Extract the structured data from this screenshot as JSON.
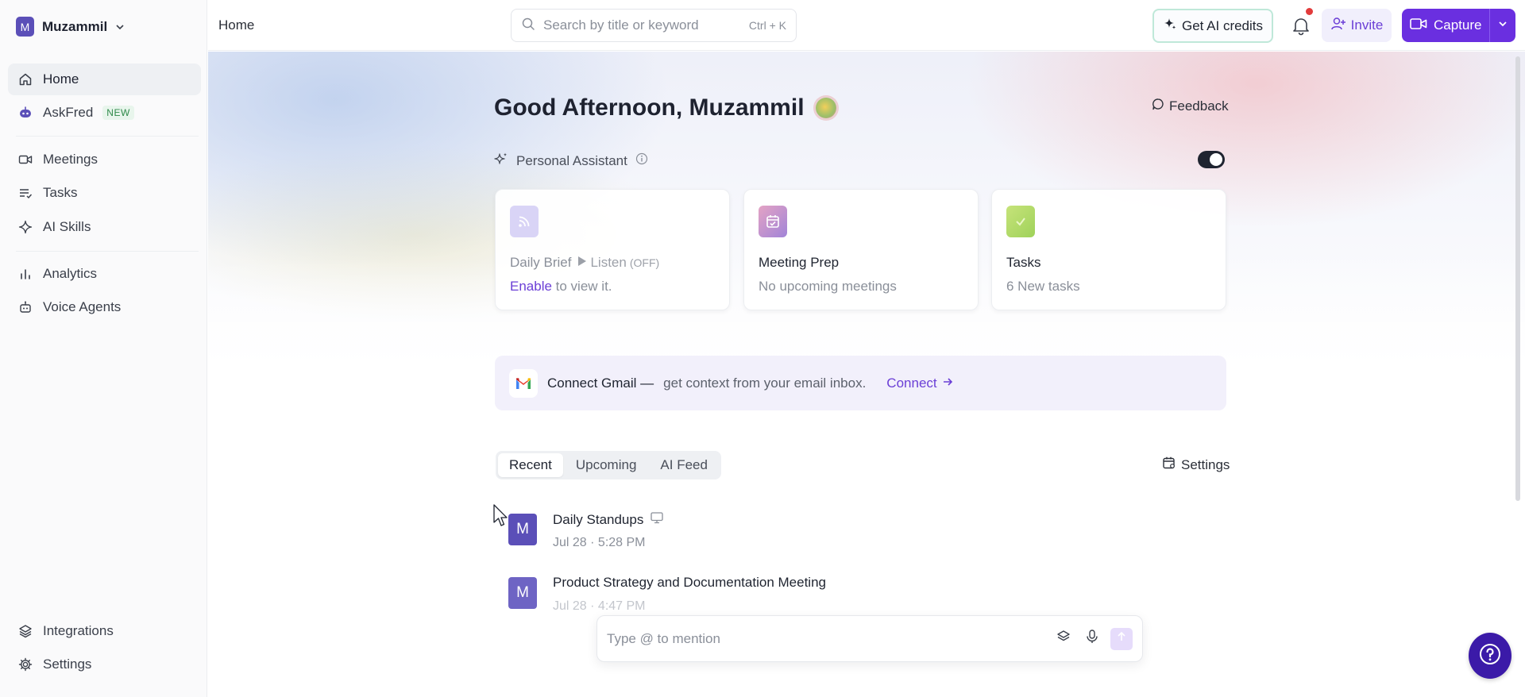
{
  "sidebar": {
    "workspace": {
      "initial": "M",
      "name": "Muzammil"
    },
    "items": [
      {
        "label": "Home",
        "icon": "home-icon"
      },
      {
        "label": "AskFred",
        "icon": "askfred-icon",
        "badge": "NEW"
      },
      {
        "label": "Meetings",
        "icon": "video-icon"
      },
      {
        "label": "Tasks",
        "icon": "tasks-icon"
      },
      {
        "label": "AI Skills",
        "icon": "sparkle-icon"
      },
      {
        "label": "Analytics",
        "icon": "analytics-icon"
      },
      {
        "label": "Voice Agents",
        "icon": "robot-icon"
      },
      {
        "label": "Integrations",
        "icon": "layers-icon"
      },
      {
        "label": "Settings",
        "icon": "gear-icon"
      }
    ]
  },
  "header": {
    "breadcrumb": "Home",
    "search": {
      "placeholder": "Search by title or keyword",
      "shortcut": "Ctrl + K"
    },
    "credits_label": "Get AI credits",
    "invite_label": "Invite",
    "capture_label": "Capture"
  },
  "main": {
    "greeting": "Good Afternoon, Muzammil",
    "feedback_label": "Feedback",
    "assistant_label": "Personal Assistant",
    "assistant_enabled": true,
    "cards": {
      "daily_brief": {
        "title": "Daily Brief",
        "listen": "Listen",
        "state": "(OFF)",
        "enable": "Enable",
        "rest": " to view it."
      },
      "meeting_prep": {
        "title": "Meeting Prep",
        "subtitle": "No upcoming meetings"
      },
      "tasks": {
        "title": "Tasks",
        "subtitle": "6 New tasks"
      }
    },
    "gmail": {
      "title": "Connect Gmail —",
      "body": "get context from your email inbox.",
      "cta": "Connect"
    },
    "tabs": [
      "Recent",
      "Upcoming",
      "AI Feed"
    ],
    "active_tab": "Recent",
    "settings_label": "Settings",
    "meetings": [
      {
        "initial": "M",
        "title": "Daily Standups",
        "date": "Jul 28",
        "time": "5:28 PM"
      },
      {
        "initial": "M",
        "title": "Product Strategy and Documentation Meeting",
        "date": "Jul 28",
        "time": "4:47 PM"
      }
    ],
    "composer_placeholder": "Type @ to mention"
  },
  "colors": {
    "brand": "#6a2fe0",
    "avatar": "#5b4fb8",
    "help": "#3b1aa8",
    "notification": "#e23b3b"
  }
}
